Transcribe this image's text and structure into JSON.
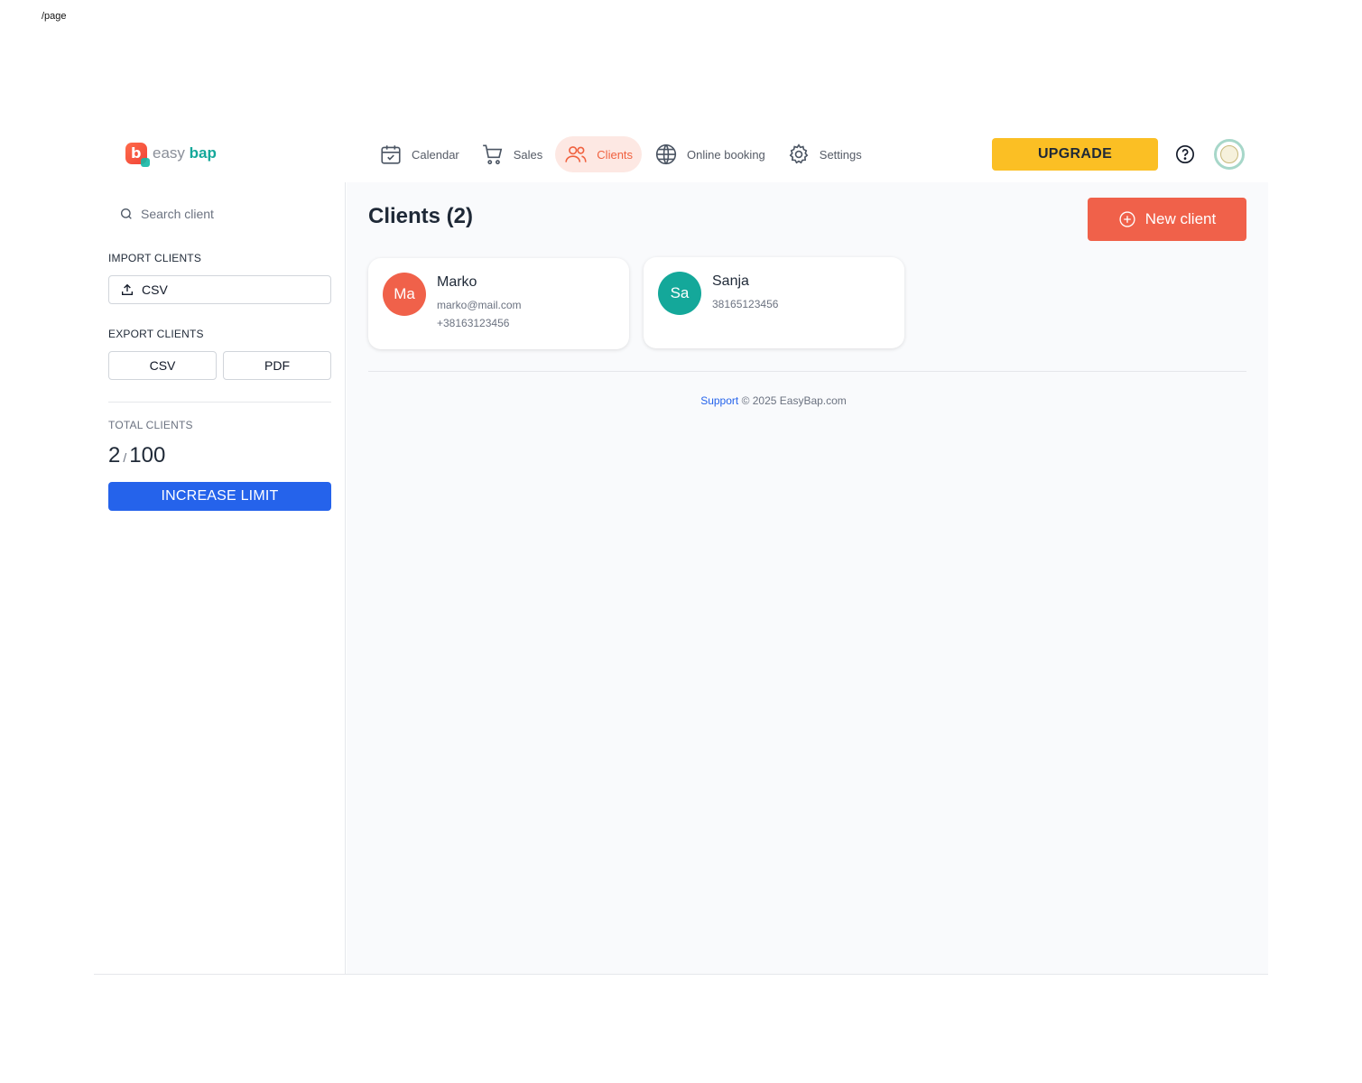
{
  "page_path": "/page",
  "brand": {
    "easy": "easy",
    "bap": "bap"
  },
  "nav": [
    {
      "label": "Calendar",
      "icon": "calendar-icon",
      "active": false
    },
    {
      "label": "Sales",
      "icon": "cart-icon",
      "active": false
    },
    {
      "label": "Clients",
      "icon": "users-icon",
      "active": true
    },
    {
      "label": "Online booking",
      "icon": "globe-icon",
      "active": false
    },
    {
      "label": "Settings",
      "icon": "gear-icon",
      "active": false
    }
  ],
  "header": {
    "upgrade_label": "UPGRADE"
  },
  "sidebar": {
    "search_placeholder": "Search client",
    "import_label": "IMPORT CLIENTS",
    "import_csv": "CSV",
    "export_label": "EXPORT CLIENTS",
    "export_csv": "CSV",
    "export_pdf": "PDF",
    "total_label": "TOTAL CLIENTS",
    "total_current": "2",
    "total_sep": "/",
    "total_limit": "100",
    "increase_label": "INCREASE LIMIT"
  },
  "main": {
    "title": "Clients (2)",
    "new_client_label": "New client",
    "clients": [
      {
        "initials": "Ma",
        "name": "Marko",
        "line1": "marko@mail.com",
        "line2": "+38163123456",
        "color": "#f0614a"
      },
      {
        "initials": "Sa",
        "name": "Sanja",
        "line1": "38165123456",
        "line2": "",
        "color": "#14a89a"
      }
    ]
  },
  "footer": {
    "support": "Support",
    "copyright": "© 2025 EasyBap.com"
  },
  "colors": {
    "accent": "#f0614a",
    "upgrade": "#fbbf24",
    "primary": "#2563eb",
    "teal": "#14a89a"
  }
}
